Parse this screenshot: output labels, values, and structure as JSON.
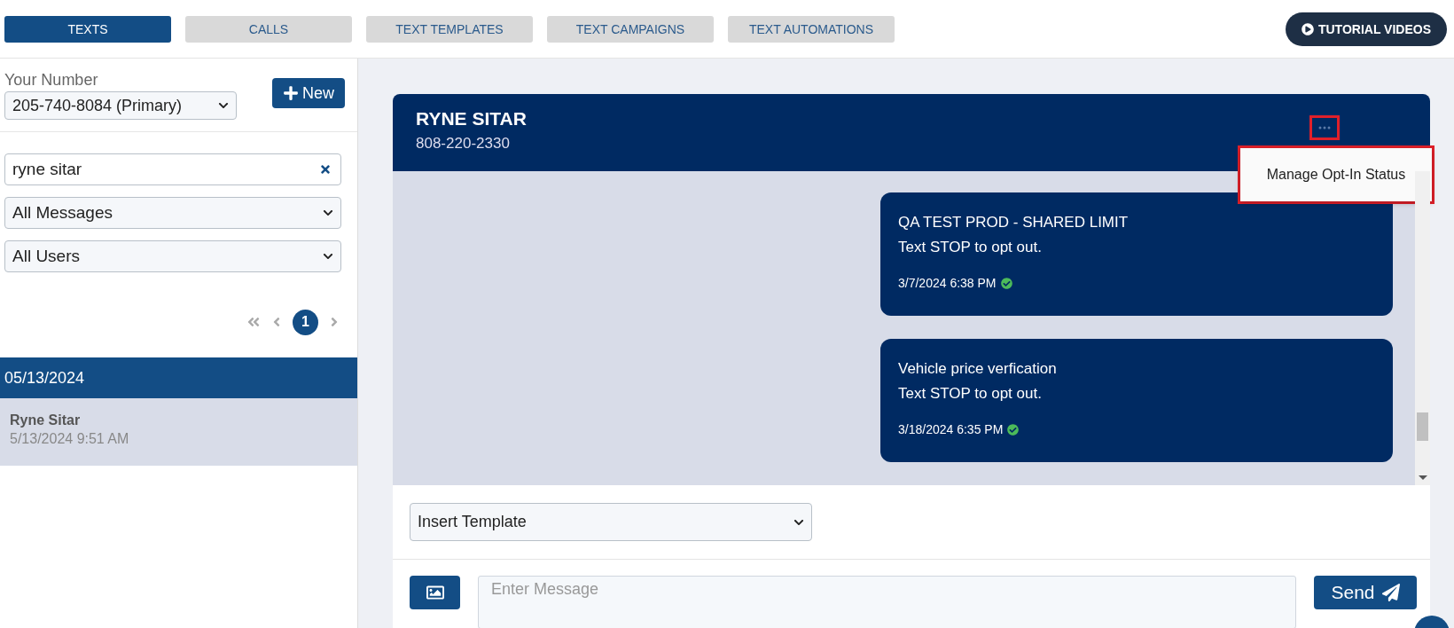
{
  "tabs": [
    {
      "label": "TEXTS",
      "selected": true
    },
    {
      "label": "CALLS",
      "selected": false
    },
    {
      "label": "TEXT TEMPLATES",
      "selected": false
    },
    {
      "label": "TEXT CAMPAIGNS",
      "selected": false
    },
    {
      "label": "TEXT AUTOMATIONS",
      "selected": false
    }
  ],
  "tutorial_button": {
    "label": "TUTORIAL VIDEOS"
  },
  "sidebar": {
    "number_label": "Your Number",
    "number_select": "205-740-8084 (Primary)",
    "new_button": "New",
    "search": {
      "value": "ryne sitar"
    },
    "filters": [
      "All Messages",
      "All Users"
    ],
    "pagination": {
      "pages": [
        {
          "label": "1",
          "selected": true
        }
      ]
    },
    "groups": [
      {
        "date": "05/13/2024",
        "conversations": [
          {
            "name": "Ryne Sitar",
            "time": "5/13/2024 9:51 AM",
            "selected": true
          }
        ]
      }
    ]
  },
  "conversation": {
    "name": "RYNE SITAR",
    "phone": "808-220-2330",
    "menu": {
      "items": [
        "Manage Opt-In Status"
      ]
    },
    "messages": [
      {
        "lines": [
          "QA TEST PROD - SHARED LIMIT",
          "Text STOP to opt out."
        ],
        "time": "3/7/2024 6:38 PM",
        "delivered": true
      },
      {
        "lines": [
          "Vehicle price verfication",
          "Text STOP to opt out."
        ],
        "time": "3/18/2024 6:35 PM",
        "delivered": true
      }
    ],
    "template_select": "Insert Template",
    "message": {
      "placeholder": "Enter Message"
    },
    "send_button": "Send"
  }
}
